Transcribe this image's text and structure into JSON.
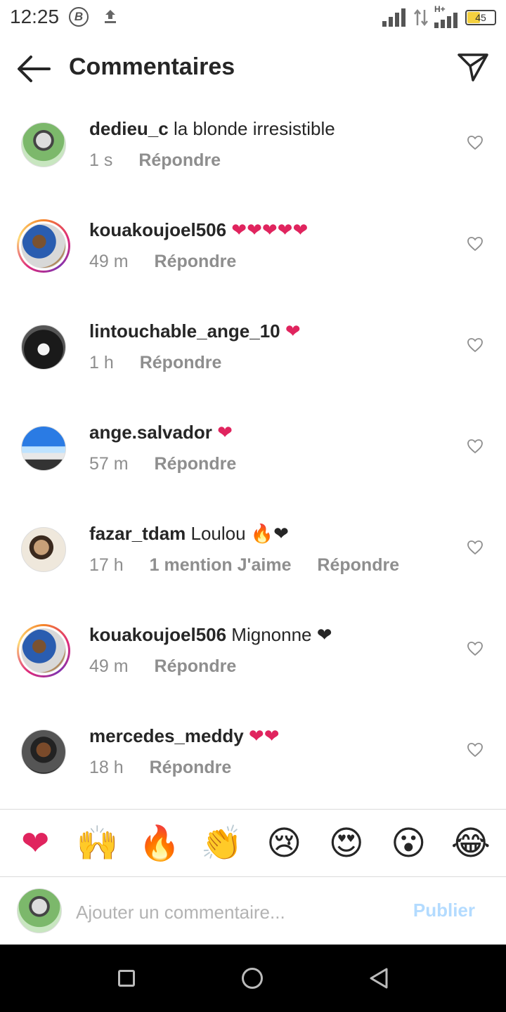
{
  "status_bar": {
    "time": "12:25",
    "b_icon_letter": "B",
    "network_label": "H+",
    "battery": "45"
  },
  "header": {
    "title": "Commentaires"
  },
  "comments": [
    {
      "username": "dedieu_c",
      "text": " la blonde irresistible",
      "time": "1 s",
      "likes": "",
      "reply": "Répondre",
      "story_ring": false
    },
    {
      "username": "kouakoujoel506",
      "text": " ❤❤❤❤❤",
      "time": "49 m",
      "likes": "",
      "reply": "Répondre",
      "story_ring": true
    },
    {
      "username": "lintouchable_ange_10",
      "text": " ❤",
      "time": "1 h",
      "likes": "",
      "reply": "Répondre",
      "story_ring": false
    },
    {
      "username": "ange.salvador",
      "text": " ❤",
      "time": "57 m",
      "likes": "",
      "reply": "Répondre",
      "story_ring": false
    },
    {
      "username": "fazar_tdam",
      "text": " Loulou 🔥❤",
      "time": "17 h",
      "likes": "1 mention J'aime",
      "reply": "Répondre",
      "story_ring": false
    },
    {
      "username": "kouakoujoel506",
      "text": " Mignonne ❤",
      "time": "49 m",
      "likes": "",
      "reply": "Répondre",
      "story_ring": true
    },
    {
      "username": "mercedes_meddy",
      "text": " ❤❤",
      "time": "18 h",
      "likes": "",
      "reply": "Répondre",
      "story_ring": false
    }
  ],
  "reactions": [
    "❤",
    "🙌",
    "🔥",
    "👏",
    "😢",
    "😍",
    "😮",
    "😂"
  ],
  "composer": {
    "placeholder": "Ajouter un commentaire...",
    "publish_label": "Publier"
  }
}
